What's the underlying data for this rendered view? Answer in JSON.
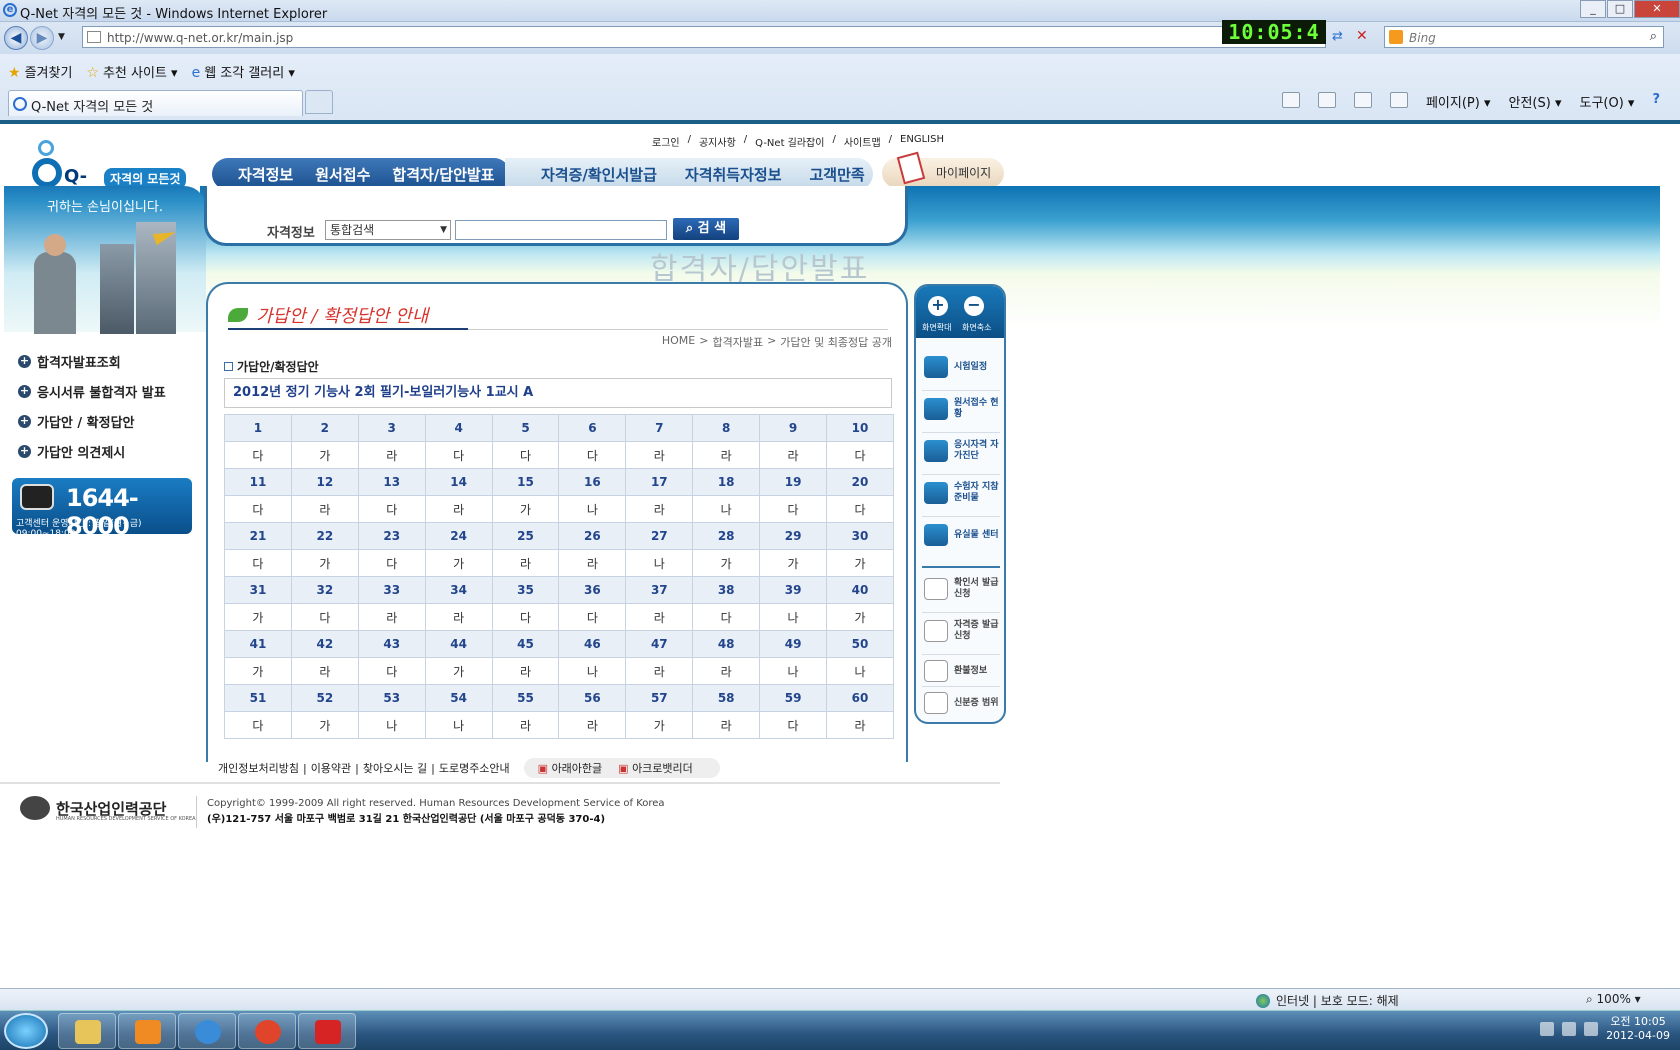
{
  "browser": {
    "window_title": "Q-Net 자격의 모든 것 - Windows Internet Explorer",
    "url": "http://www.q-net.or.kr/main.jsp",
    "clock_display": "10:05:4",
    "search_placeholder": "Bing",
    "favorites": [
      "즐겨찾기",
      "추천 사이트 ▾",
      "웹 조각 갤러리 ▾"
    ],
    "tab_title": "Q-Net 자격의 모든 것",
    "commands": [
      "페이지(P) ▾",
      "안전(S) ▾",
      "도구(O) ▾"
    ],
    "status_zone": "인터넷 | 보호 모드: 해제",
    "zoom": "100%"
  },
  "site": {
    "logo_text": "Q-Net",
    "logo_tagline": "자격의 모든것",
    "top_links": [
      "로그인",
      "/",
      "공지사항",
      "/",
      "Q-Net 길라잡이",
      "/",
      "사이트맵",
      "/",
      "ENGLISH"
    ],
    "main_nav_primary": [
      "자격정보",
      "원서접수",
      "합격자/답안발표"
    ],
    "main_nav_secondary": [
      "자격증/확인서발급",
      "자격취득자정보",
      "고객만족"
    ],
    "mypage_label": "마이페이지",
    "greeting": "귀하는 손님이십니다.",
    "search": {
      "label": "자격정보",
      "select_value": "통합검색",
      "input_value": "",
      "button_label": "검 색"
    },
    "section_title": "합격자/답안발표",
    "left_menu": [
      "합격자발표조회",
      "응시서류 불합격자 발표",
      "가답안 / 확정답안",
      "가답안 의견제시"
    ],
    "phone": {
      "number": "1644-8000",
      "hours": "고객센터 운영시간 : 평일(월~금) 09:00~18:00"
    }
  },
  "content": {
    "title": "가답안 / 확정답안 안내",
    "breadcrumb": [
      "HOME",
      ">",
      "합격자발표",
      ">",
      "가답안 및 최종정답 공개"
    ],
    "subtitle": "가답안/확정답안",
    "exam_title": "2012년 정기 기능사 2회 필기-보일러기능사 1교시 A",
    "answer_rows": [
      {
        "q": [
          "1",
          "2",
          "3",
          "4",
          "5",
          "6",
          "7",
          "8",
          "9",
          "10"
        ],
        "a": [
          "다",
          "가",
          "라",
          "다",
          "다",
          "다",
          "라",
          "라",
          "라",
          "다"
        ]
      },
      {
        "q": [
          "11",
          "12",
          "13",
          "14",
          "15",
          "16",
          "17",
          "18",
          "19",
          "20"
        ],
        "a": [
          "다",
          "라",
          "다",
          "라",
          "가",
          "나",
          "라",
          "나",
          "다",
          "다"
        ]
      },
      {
        "q": [
          "21",
          "22",
          "23",
          "24",
          "25",
          "26",
          "27",
          "28",
          "29",
          "30"
        ],
        "a": [
          "다",
          "가",
          "다",
          "가",
          "라",
          "라",
          "나",
          "가",
          "가",
          "가"
        ]
      },
      {
        "q": [
          "31",
          "32",
          "33",
          "34",
          "35",
          "36",
          "37",
          "38",
          "39",
          "40"
        ],
        "a": [
          "가",
          "다",
          "라",
          "라",
          "다",
          "다",
          "라",
          "다",
          "나",
          "가"
        ]
      },
      {
        "q": [
          "41",
          "42",
          "43",
          "44",
          "45",
          "46",
          "47",
          "48",
          "49",
          "50"
        ],
        "a": [
          "가",
          "라",
          "다",
          "가",
          "라",
          "나",
          "라",
          "라",
          "나",
          "나"
        ]
      },
      {
        "q": [
          "51",
          "52",
          "53",
          "54",
          "55",
          "56",
          "57",
          "58",
          "59",
          "60"
        ],
        "a": [
          "다",
          "가",
          "나",
          "나",
          "라",
          "라",
          "가",
          "라",
          "다",
          "라"
        ]
      }
    ]
  },
  "quick_menu": {
    "zoom_in": "화면확대",
    "zoom_out": "화면축소",
    "items": [
      "시험일정",
      "원서접수 현황",
      "응시자격 자가진단",
      "수험자 지참준비물",
      "유실물 센터"
    ],
    "items2": [
      "확인서 발급신청",
      "자격증 발급신청",
      "환불정보",
      "신분증 범위"
    ]
  },
  "footer": {
    "links": [
      "개인정보처리방침",
      "|",
      "이용약관",
      "|",
      "찾아오시는 길",
      "|",
      "도로명주소안내"
    ],
    "downloads": [
      "아래아한글",
      "아크로뱃리더"
    ],
    "org_name": "한국산업인력공단",
    "org_name_en": "HUMAN RESOURCES DEVELOPMENT SERVICE OF KOREA",
    "copyright": "Copyright© 1999-2009 All right reserved. Human Resources Development Service of Korea",
    "address": "(우)121-757 서울 마포구 백범로 31길 21 한국산업인력공단 (서울 마포구 공덕동 370-4)"
  },
  "taskbar": {
    "time": "오전 10:05",
    "date": "2012-04-09"
  }
}
